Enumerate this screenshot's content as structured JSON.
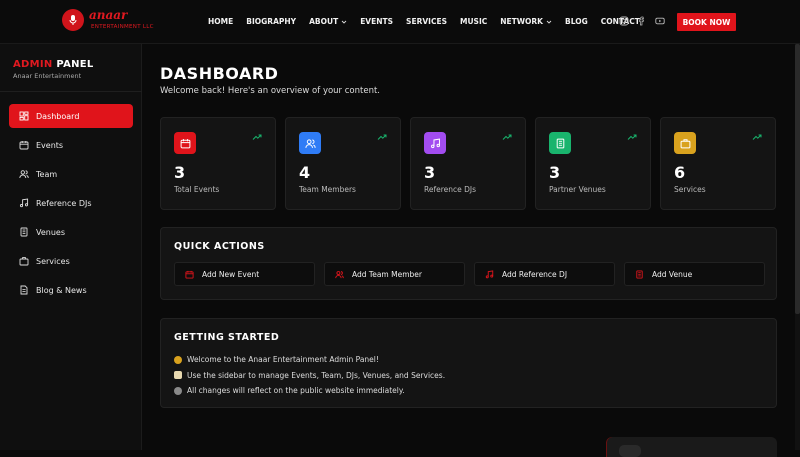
{
  "brand": {
    "name": "anaar",
    "sub": "ENTERTAINMENT LLC"
  },
  "nav": [
    "HOME",
    "BIOGRAPHY",
    "ABOUT",
    "EVENTS",
    "SERVICES",
    "MUSIC",
    "NETWORK",
    "BLOG",
    "CONTACT"
  ],
  "book_label": "BOOK NOW",
  "sidebar": {
    "title_a": "ADMIN",
    "title_b": " PANEL",
    "sub": "Anaar Entertainment",
    "items": [
      {
        "label": "Dashboard",
        "icon": "dashboard-icon"
      },
      {
        "label": "Events",
        "icon": "calendar-icon"
      },
      {
        "label": "Team",
        "icon": "users-icon"
      },
      {
        "label": "Reference DJs",
        "icon": "music-icon"
      },
      {
        "label": "Venues",
        "icon": "building-icon"
      },
      {
        "label": "Services",
        "icon": "briefcase-icon"
      },
      {
        "label": "Blog & News",
        "icon": "document-icon"
      }
    ]
  },
  "main": {
    "title": "DASHBOARD",
    "subtitle": "Welcome back! Here's an overview of your content."
  },
  "stats": [
    {
      "value": "3",
      "label": "Total Events",
      "color": "#e0141b",
      "icon": "calendar-icon"
    },
    {
      "value": "4",
      "label": "Team Members",
      "color": "#2f7cf6",
      "icon": "users-icon"
    },
    {
      "value": "3",
      "label": "Reference DJs",
      "color": "#a24cf0",
      "icon": "music-icon"
    },
    {
      "value": "3",
      "label": "Partner Venues",
      "color": "#19b46d",
      "icon": "building-icon"
    },
    {
      "value": "6",
      "label": "Services",
      "color": "#d9a21e",
      "icon": "briefcase-icon"
    }
  ],
  "quick_actions": {
    "title": "QUICK ACTIONS",
    "items": [
      {
        "label": "Add New Event",
        "icon": "calendar-icon"
      },
      {
        "label": "Add Team Member",
        "icon": "users-icon"
      },
      {
        "label": "Add Reference DJ",
        "icon": "music-icon"
      },
      {
        "label": "Add Venue",
        "icon": "building-icon"
      }
    ]
  },
  "getting_started": {
    "title": "GETTING STARTED",
    "lines": [
      "Welcome to the Anaar Entertainment Admin Panel!",
      "Use the sidebar to manage Events, Team, DJs, Venues, and Services.",
      "All changes will reflect on the public website immediately."
    ]
  },
  "accent": "#e0141b",
  "trend_color": "#19b46d"
}
